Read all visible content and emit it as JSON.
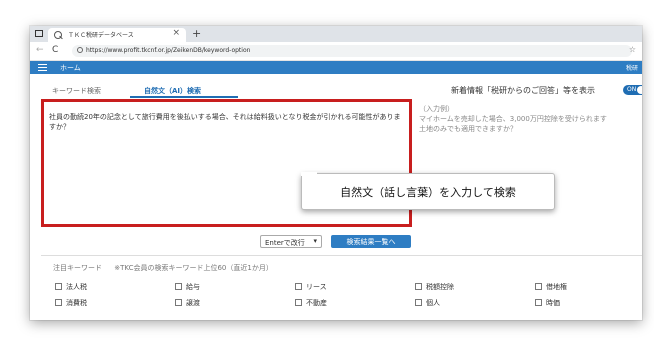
{
  "browser": {
    "tab_title": "ＴＫＣ税研データベース",
    "tab_close": "×",
    "new_tab": "+",
    "back": "←",
    "reload": "C",
    "url": "https://www.profit.tkcnf.or.jp/ZeikenDB/keyword-option",
    "star": "☆"
  },
  "appbar": {
    "home_label": "ホーム",
    "right_label": "税研",
    "bar_color": "#2e7dc3"
  },
  "tabs": {
    "keyword": "キーワード検索",
    "natural": "自然文（AI）検索"
  },
  "news": {
    "label": "新着情報「税研からのご回答」等を表示",
    "toggle_label": "ON",
    "toggle_state": "on"
  },
  "question": {
    "text": "社員の勤続20年の記念として旅行費用を後払いする場合、それは給料扱いとなり税金が引かれる可能性がありますか？"
  },
  "example": {
    "head": "（入力例）",
    "line1": "マイホームを売却した場合、3,000万円控除を受けられます",
    "line2": "土地のみでも適用できますか？"
  },
  "callout": {
    "text": "自然文（話し言葉）を入力して検索"
  },
  "buttons": {
    "enter_label": "Enterで改行",
    "enter_chevron": "▾",
    "search_label": "検索結果一覧へ"
  },
  "keywords_section": {
    "title": "注目キーワード",
    "note": "※TKC会員の検索キーワード上位60（直近1か月）",
    "items": [
      "法人税",
      "給与",
      "リース",
      "税額控除",
      "借地権",
      "消費税",
      "譲渡",
      "不動産",
      "個人",
      "時価"
    ]
  },
  "colors": {
    "highlight_border": "#c81e1e",
    "accent": "#1f6db3"
  }
}
